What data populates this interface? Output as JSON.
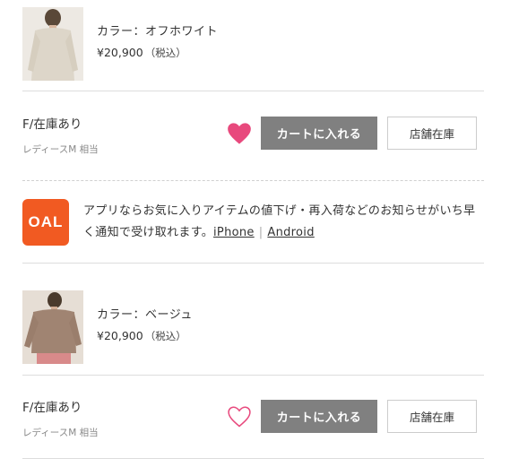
{
  "products": [
    {
      "image": "model-offwhite-sweater",
      "color_label": "カラー：オフホワイト",
      "price": "¥20,900",
      "tax": "（税込）",
      "stock_status": "F/在庫あり",
      "size_note": "レディースM 相当",
      "favorite": true,
      "cart_label": "カートに入れる",
      "store_label": "店舗在庫"
    },
    {
      "image": "model-beige-sweater",
      "color_label": "カラー：ベージュ",
      "price": "¥20,900",
      "tax": "（税込）",
      "stock_status": "F/在庫あり",
      "size_note": "レディースM 相当",
      "favorite": false,
      "cart_label": "カートに入れる",
      "store_label": "店舗在庫"
    }
  ],
  "app_banner": {
    "logo_text": "OAL",
    "message": "アプリならお気に入りアイテムの値下げ・再入荷などのお知らせがいち早く通知で受け取れます。",
    "iphone_link": "iPhone",
    "separator": "|",
    "android_link": "Android"
  },
  "colors": {
    "favorite_active": "#e8497d",
    "favorite_outline": "#e8497d",
    "cart_button": "#808080",
    "app_logo_bg": "#f15a22"
  }
}
